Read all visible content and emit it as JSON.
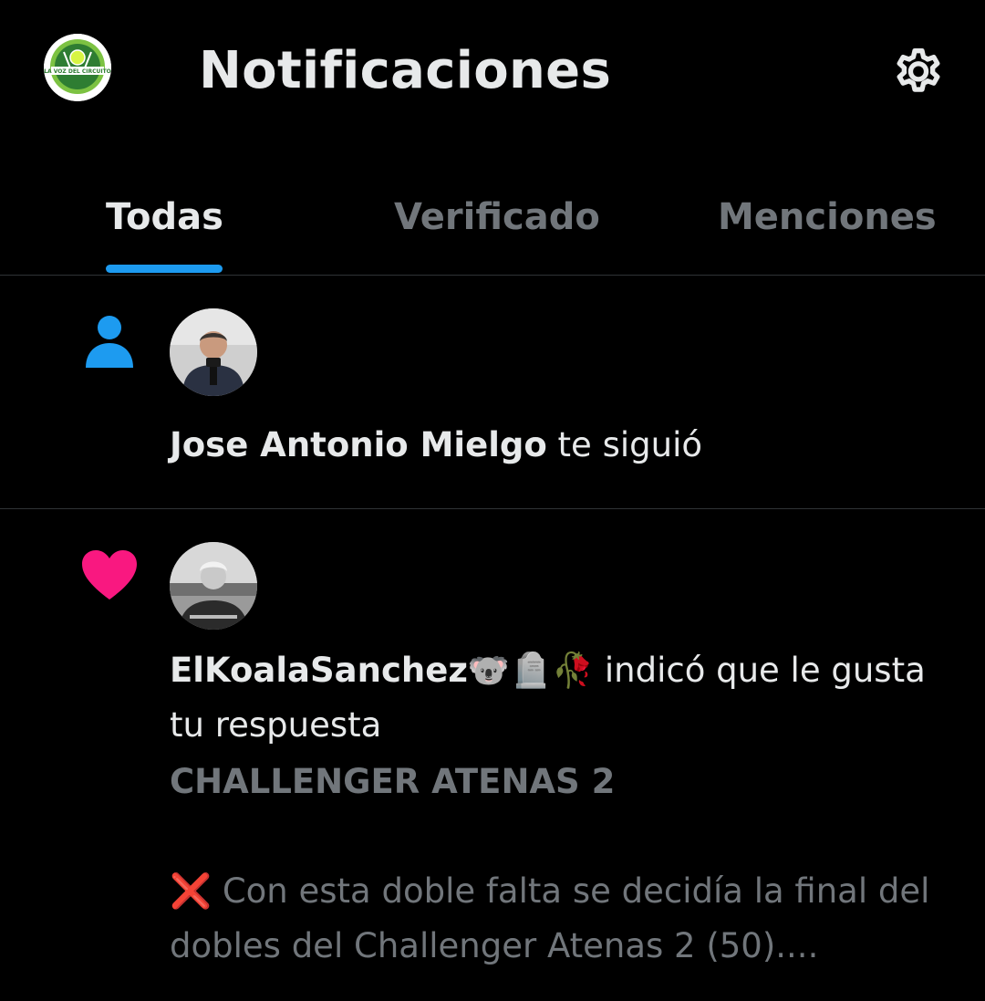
{
  "header": {
    "title": "Notificaciones",
    "avatar_icon": "tennis-club-logo-avatar",
    "avatar_text": "LA VOZ DEL CIRCUITO",
    "settings_icon": "gear-icon"
  },
  "tabs": [
    {
      "label": "Todas",
      "active": true
    },
    {
      "label": "Verificado",
      "active": false
    },
    {
      "label": "Menciones",
      "active": false
    }
  ],
  "notifications": [
    {
      "type": "follow",
      "icon": "person-icon",
      "icon_color": "#1d9bf0",
      "user": "Jose Antonio Mielgo",
      "action": " te siguió"
    },
    {
      "type": "like",
      "icon": "heart-icon",
      "icon_color": "#f91880",
      "user": "ElKoalaSanchez🐨🪦🥀",
      "action": " indicó que le gusta tu respuesta",
      "tweet_heading": "CHALLENGER ATENAS 2",
      "tweet_body": "❌ Con esta doble falta se decidía la final del dobles del Challenger Atenas 2 (50)...."
    }
  ],
  "colors": {
    "background": "#000000",
    "text_primary": "#e7e9ea",
    "text_secondary": "#71767b",
    "accent": "#1d9bf0",
    "divider": "#2f3336"
  }
}
